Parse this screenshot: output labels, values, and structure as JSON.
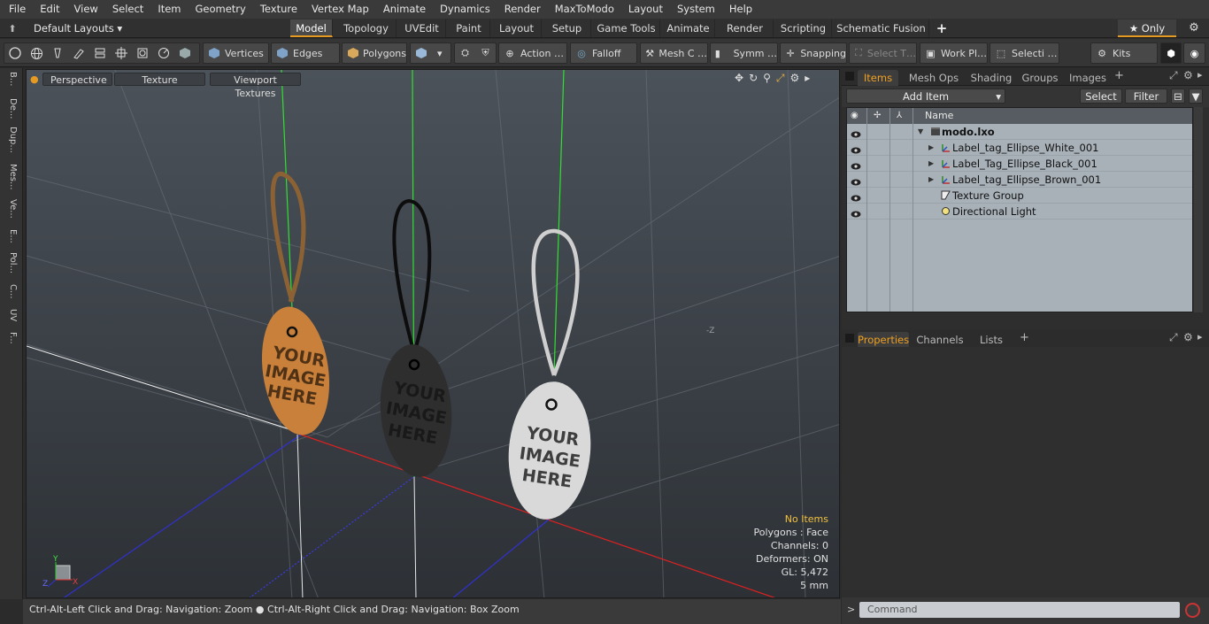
{
  "menubar": {
    "items": [
      "File",
      "Edit",
      "View",
      "Select",
      "Item",
      "Geometry",
      "Texture",
      "Vertex Map",
      "Animate",
      "Dynamics",
      "Render",
      "MaxToModo",
      "Layout",
      "System",
      "Help"
    ]
  },
  "tabbar": {
    "layouts_label": "Default Layouts ▾",
    "tabs": [
      "Model",
      "Topology",
      "UVEdit",
      "Paint",
      "Layout",
      "Setup",
      "Game Tools",
      "Animate",
      "Render",
      "Scripting",
      "Schematic Fusion"
    ],
    "active_tab": "Model",
    "add_symbol": "+",
    "only_label": "★ Only"
  },
  "toolbar": {
    "vertices": "Vertices",
    "edges": "Edges",
    "polygons": "Polygons",
    "action": "Action …",
    "falloff": "Falloff",
    "mesh": "Mesh C …",
    "symm": "Symm …",
    "snapping": "Snapping",
    "selectt": "Select T…",
    "workpl": "Work Pl…",
    "selecti": "Selecti …",
    "kits": "Kits"
  },
  "left_tabs": [
    "B...",
    "De...",
    "Dup...",
    "Mes...",
    "Ve...",
    "E...",
    "Pol...",
    "C...",
    "UV",
    "F..."
  ],
  "viewport": {
    "perspective": "Perspective",
    "texture": "Texture",
    "viewport_textures": "Viewport Textures",
    "axis_z_label": "-Z",
    "tag_text": [
      "YOUR",
      "IMAGE",
      "HERE"
    ],
    "info": {
      "no_items": "No Items",
      "polygons": "Polygons : Face",
      "channels": "Channels: 0",
      "deformers": "Deformers: ON",
      "gl": "GL: 5,472",
      "unit": "5 mm"
    },
    "gizmo_x": "X",
    "gizmo_y": "Y",
    "gizmo_z": "Z"
  },
  "statusbar": {
    "text1": "Ctrl-Alt-Left Click and Drag: Navigation: Zoom",
    "text2": "Ctrl-Alt-Right Click and Drag: Navigation: Box Zoom"
  },
  "items_panel": {
    "tabs": [
      "Items",
      "Mesh Ops",
      "Shading",
      "Groups",
      "Images"
    ],
    "active_tab": "Items",
    "add_item": "Add Item",
    "select": "Select",
    "filter": "Filter",
    "column_name": "Name",
    "rows": [
      {
        "label": "modo.lxo",
        "depth": 0,
        "arrow": "▼",
        "bold": true
      },
      {
        "label": "Label_tag_Ellipse_White_001",
        "depth": 1,
        "arrow": "▶"
      },
      {
        "label": "Label_Tag_Ellipse_Black_001",
        "depth": 1,
        "arrow": "▶"
      },
      {
        "label": "Label_tag_Ellipse_Brown_001",
        "depth": 1,
        "arrow": "▶"
      },
      {
        "label": "Texture Group",
        "depth": 1,
        "arrow": ""
      },
      {
        "label": "Directional Light",
        "depth": 1,
        "arrow": ""
      }
    ]
  },
  "properties_panel": {
    "tabs": [
      "Properties",
      "Channels",
      "Lists"
    ],
    "active_tab": "Properties"
  },
  "command": {
    "prompt": ">",
    "placeholder": "Command"
  },
  "colors": {
    "accent": "#e59a22",
    "brown_tag": "#c9803a",
    "black_tag": "#2e2e2e",
    "white_tag": "#d9d9d9"
  }
}
